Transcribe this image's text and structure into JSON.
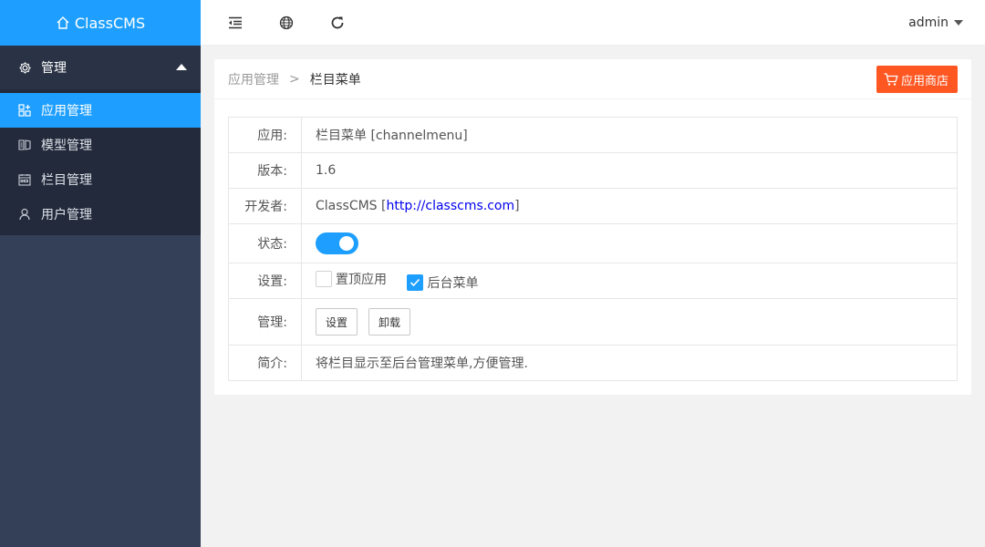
{
  "logo": {
    "text": "ClassCMS"
  },
  "sidebar": {
    "group_label": "管理",
    "items": [
      {
        "label": "应用管理",
        "active": true
      },
      {
        "label": "模型管理",
        "active": false
      },
      {
        "label": "栏目管理",
        "active": false
      },
      {
        "label": "用户管理",
        "active": false
      }
    ]
  },
  "topbar": {
    "user": "admin"
  },
  "breadcrumb": {
    "parent": "应用管理",
    "separator": ">",
    "current": "栏目菜单"
  },
  "store_button": {
    "label": "应用商店"
  },
  "info": {
    "app_label": "应用:",
    "app_value": "栏目菜单 [channelmenu]",
    "version_label": "版本:",
    "version_value": "1.6",
    "dev_label": "开发者:",
    "dev_name": "ClassCMS",
    "dev_open": "[",
    "dev_url": "http://classcms.com",
    "dev_close": "]",
    "status_label": "状态:",
    "status_on": true,
    "settings_label": "设置:",
    "setting_top": {
      "label": "置顶应用",
      "checked": false
    },
    "setting_menu": {
      "label": "后台菜单",
      "checked": true
    },
    "manage_label": "管理:",
    "manage_settings_btn": "设置",
    "manage_uninstall_btn": "卸载",
    "intro_label": "简介:",
    "intro_value": "将栏目显示至后台管理菜单,方便管理."
  },
  "colors": {
    "primary": "#1e9fff",
    "sidebar": "#344058",
    "store": "#ff5722"
  }
}
